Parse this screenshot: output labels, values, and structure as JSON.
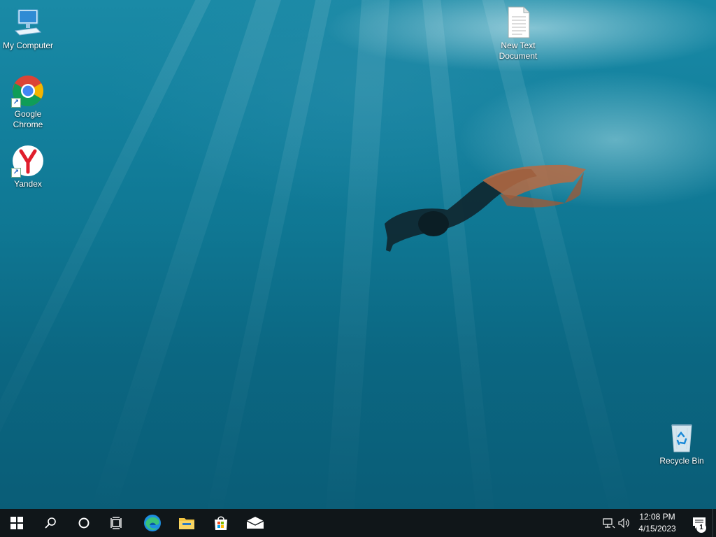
{
  "desktop": {
    "icons": [
      {
        "label": "My Computer",
        "icon": "computer-icon"
      },
      {
        "label": "Google Chrome",
        "icon": "chrome-icon",
        "shortcut": true
      },
      {
        "label": "Yandex",
        "icon": "yandex-icon",
        "shortcut": true
      },
      {
        "label": "New Text Document",
        "icon": "text-document-icon"
      },
      {
        "label": "Recycle Bin",
        "icon": "recycle-bin-icon"
      }
    ]
  },
  "taskbar": {
    "buttons": [
      {
        "name": "start",
        "icon": "windows-logo-icon"
      },
      {
        "name": "search",
        "icon": "search-icon"
      },
      {
        "name": "cortana",
        "icon": "cortana-circle-icon"
      },
      {
        "name": "task-view",
        "icon": "task-view-icon"
      },
      {
        "name": "edge",
        "icon": "edge-icon"
      },
      {
        "name": "file-explorer",
        "icon": "folder-icon"
      },
      {
        "name": "store",
        "icon": "store-icon"
      },
      {
        "name": "mail",
        "icon": "mail-icon"
      }
    ],
    "tray": {
      "network_icon": "network-icon",
      "volume_icon": "volume-icon",
      "time": "12:08 PM",
      "date": "4/15/2023",
      "notifications_count": "1"
    }
  },
  "colors": {
    "taskbar": "#101619",
    "water_top": "#1a8aa6",
    "water_bottom": "#0a5d77",
    "text": "#ffffff"
  }
}
